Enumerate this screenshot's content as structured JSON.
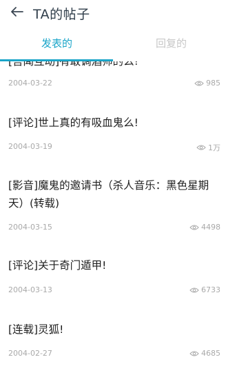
{
  "header": {
    "title": "TA的帖子"
  },
  "tabs": [
    {
      "label": "发表的",
      "active": true
    },
    {
      "label": "回复的",
      "active": false
    }
  ],
  "posts": [
    {
      "title": "[吾闻互动]有敢调酒师的么!",
      "date": "2004-03-22",
      "views": "985"
    },
    {
      "title": "[评论]世上真的有吸血鬼么!",
      "date": "2004-03-19",
      "views": "1万"
    },
    {
      "title": "[影音]魔鬼的邀请书（杀人音乐：黑色星期天）(转载)",
      "date": "2004-03-15",
      "views": "4498"
    },
    {
      "title": "[评论]关于奇门遁甲!",
      "date": "2004-03-13",
      "views": "6733"
    },
    {
      "title": "[连载]灵狐!",
      "date": "2004-02-27",
      "views": "4685"
    }
  ],
  "colors": {
    "accent": "#1aa5c9",
    "text_primary": "#1f1f1f",
    "text_muted": "#a9a9a9",
    "tab_inactive": "#c7c7c7"
  },
  "icons": {
    "back": "arrow-left-icon",
    "views": "eye-icon"
  }
}
